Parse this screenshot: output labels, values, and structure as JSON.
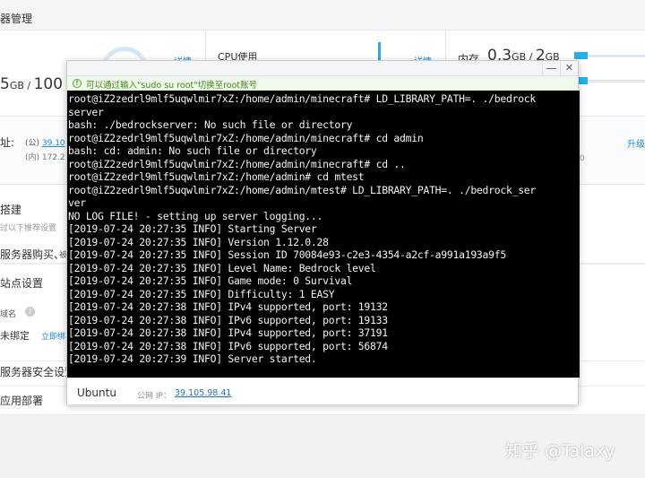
{
  "dashboard": {
    "title": "器管理",
    "disk": {
      "value": "5",
      "unit": "GB",
      "sep": " / ",
      "total": "100"
    },
    "detail_label": "详情",
    "cpu": {
      "label": "CPU使用"
    },
    "memory": {
      "label": "内存",
      "used": "0.3",
      "used_unit": "GB",
      "sep": " / ",
      "total": "2",
      "total_unit": "GB"
    },
    "address": {
      "label": "址:",
      "public_prefix": "(公) ",
      "public_value": "39.10",
      "private_prefix": "(内) ",
      "private_value": "172.2",
      "upgrade": "升级",
      "trailing_digit": "0"
    },
    "sections": {
      "build": {
        "title": "搭建",
        "sub": "过以下推荐设置"
      },
      "purchase": {
        "title": "服务器购买、",
        "suffix": "被"
      },
      "site": {
        "title": "站点设置"
      },
      "domain": {
        "label": "域名",
        "status": "未绑定",
        "bind_link": "立即绑"
      },
      "security": {
        "title": "服务器安全设置"
      },
      "deploy": {
        "title": "应用部署"
      }
    }
  },
  "terminal": {
    "minimize": "—",
    "close": "✕",
    "tip": "可以通过输入\"sudo su root\"切换至root账号",
    "lines": [
      "root@iZ2zedrl9mlf5uqwlmir7xZ:/home/admin/minecraft# LD_LIBRARY_PATH=. ./bedrock",
      "server",
      "bash: ./bedrockserver: No such file or directory",
      "root@iZ2zedrl9mlf5uqwlmir7xZ:/home/admin/minecraft# cd admin",
      "bash: cd: admin: No such file or directory",
      "root@iZ2zedrl9mlf5uqwlmir7xZ:/home/admin/minecraft# cd ..",
      "root@iZ2zedrl9mlf5uqwlmir7xZ:/home/admin# cd mtest",
      "root@iZ2zedrl9mlf5uqwlmir7xZ:/home/admin/mtest# LD_LIBRARY_PATH=. ./bedrock_ser",
      "ver",
      "NO LOG FILE! - setting up server logging...",
      "[2019-07-24 20:27:35 INFO] Starting Server",
      "[2019-07-24 20:27:35 INFO] Version 1.12.0.28",
      "[2019-07-24 20:27:35 INFO] Session ID 70084e93-c2e3-4354-a2cf-a991a193a9f5",
      "[2019-07-24 20:27:35 INFO] Level Name: Bedrock level",
      "[2019-07-24 20:27:35 INFO] Game mode: 0 Survival",
      "[2019-07-24 20:27:35 INFO] Difficulty: 1 EASY",
      "[2019-07-24 20:27:38 INFO] IPv4 supported, port: 19132",
      "[2019-07-24 20:27:38 INFO] IPv6 supported, port: 19133",
      "[2019-07-24 20:27:38 INFO] IPv4 supported, port: 37191",
      "[2019-07-24 20:27:38 INFO] IPv6 supported, port: 56874",
      "[2019-07-24 20:27:39 INFO] Server started."
    ],
    "os_name": "Ubuntu",
    "public_ip_label": "公网 IP：",
    "public_ip": "39.105.98.41"
  },
  "watermark": "知乎 @Talaxy",
  "colors": {
    "accent": "#1f8bd6",
    "bar": "#26b2e8",
    "tip_green": "#3c8a12"
  }
}
